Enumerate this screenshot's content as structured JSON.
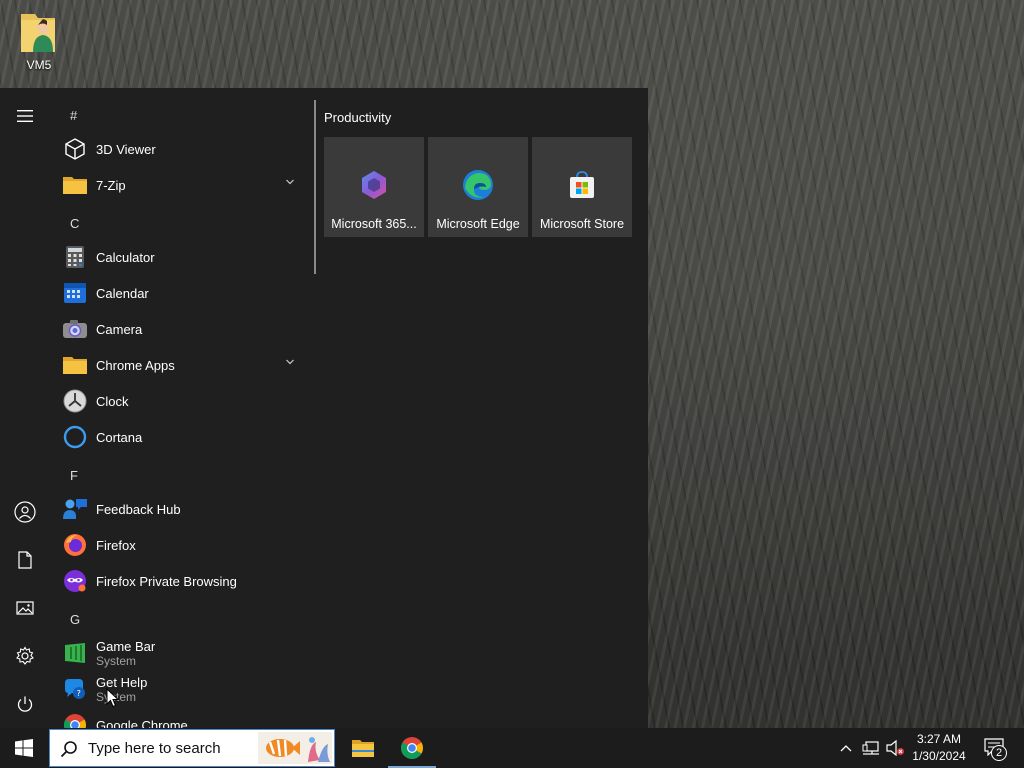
{
  "desktop": {
    "icons": [
      {
        "label": "VM5",
        "icon": "user-folder-icon"
      }
    ]
  },
  "start_menu": {
    "rail": [
      {
        "name": "menu",
        "icon": "hamburger-icon"
      },
      {
        "name": "account",
        "icon": "user-icon"
      },
      {
        "name": "documents",
        "icon": "document-icon"
      },
      {
        "name": "pictures",
        "icon": "pictures-icon"
      },
      {
        "name": "settings",
        "icon": "gear-icon"
      },
      {
        "name": "power",
        "icon": "power-icon"
      }
    ],
    "letters": {
      "hash": "#",
      "c": "C",
      "f": "F",
      "g": "G"
    },
    "apps": {
      "viewer3d": {
        "label": "3D Viewer",
        "icon": "cube-icon"
      },
      "zip7": {
        "label": "7-Zip",
        "icon": "folder-icon"
      },
      "calculator": {
        "label": "Calculator",
        "icon": "calculator-icon"
      },
      "calendar": {
        "label": "Calendar",
        "icon": "calendar-icon"
      },
      "camera": {
        "label": "Camera",
        "icon": "camera-icon"
      },
      "chrome_apps": {
        "label": "Chrome Apps",
        "icon": "folder-icon"
      },
      "clock": {
        "label": "Clock",
        "icon": "clock-icon"
      },
      "cortana": {
        "label": "Cortana",
        "icon": "cortana-icon"
      },
      "feedback_hub": {
        "label": "Feedback Hub",
        "icon": "feedback-icon"
      },
      "firefox": {
        "label": "Firefox",
        "icon": "firefox-icon"
      },
      "firefox_private": {
        "label": "Firefox Private Browsing",
        "icon": "firefox-private-icon"
      },
      "game_bar": {
        "label": "Game Bar",
        "sublabel": "System",
        "icon": "xbox-gamebar-icon"
      },
      "get_help": {
        "label": "Get Help",
        "sublabel": "System",
        "icon": "help-icon"
      },
      "google_chrome": {
        "label": "Google Chrome",
        "icon": "chrome-icon"
      }
    },
    "tiles_group": {
      "title": "Productivity",
      "tiles": [
        {
          "label": "Microsoft 365...",
          "icon": "microsoft-365-icon"
        },
        {
          "label": "Microsoft Edge",
          "icon": "edge-icon"
        },
        {
          "label": "Microsoft Store",
          "icon": "store-icon"
        }
      ]
    }
  },
  "taskbar": {
    "search_placeholder": "Type here to search",
    "pinned": [
      {
        "name": "File Explorer",
        "icon": "file-explorer-icon"
      },
      {
        "name": "Google Chrome",
        "icon": "chrome-icon",
        "active": true
      }
    ],
    "clock": {
      "time": "3:27 AM",
      "date": "1/30/2024"
    },
    "notification_count": "2"
  },
  "colors": {
    "start_bg": "#1f1f1f",
    "tile_bg": "#3a3a3a",
    "taskbar_bg": "#1c1c1c",
    "accent": "#0078d4"
  }
}
